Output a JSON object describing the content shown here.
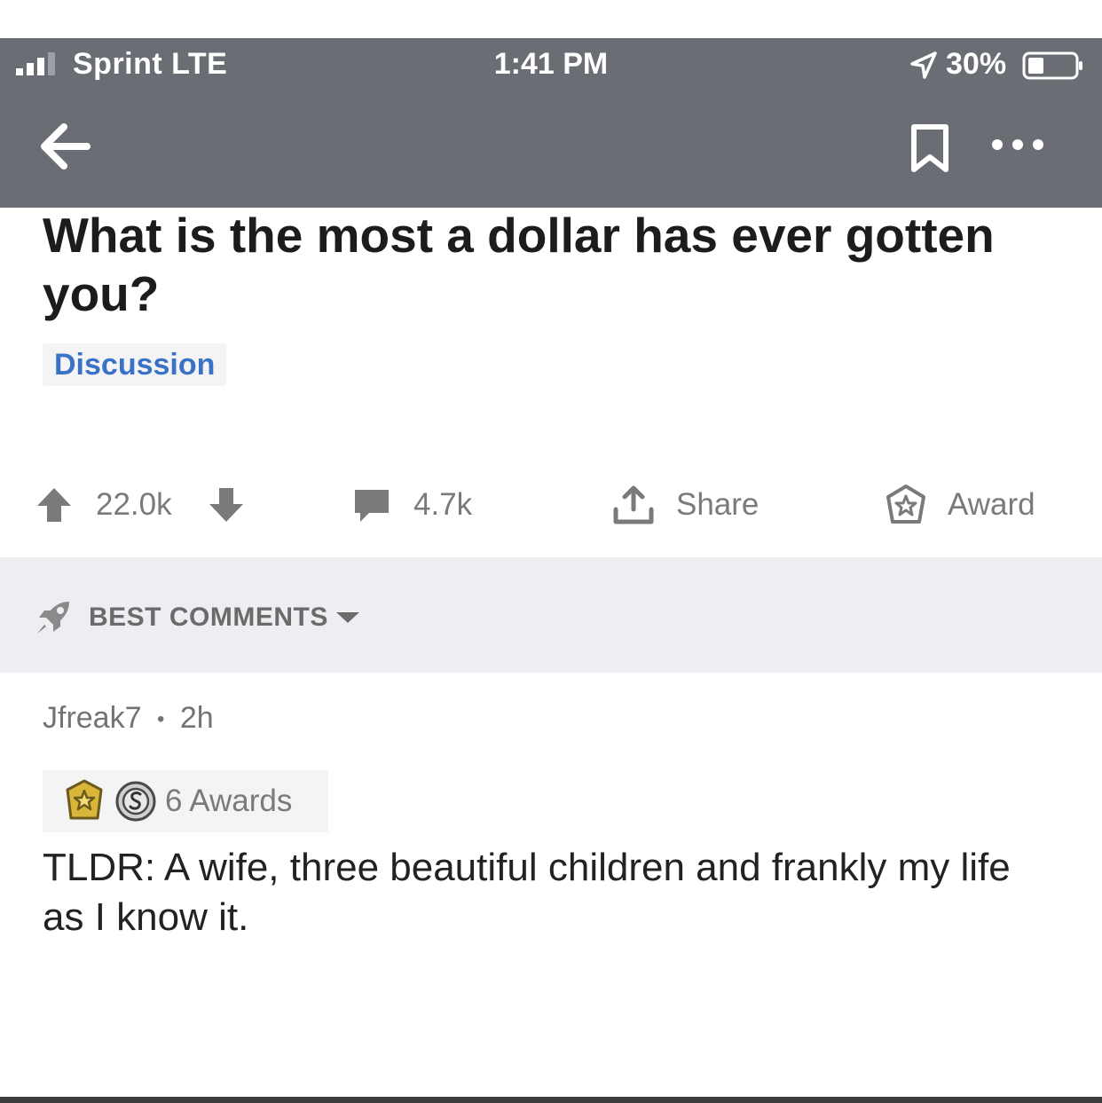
{
  "status_bar": {
    "carrier": "Sprint LTE",
    "time": "1:41 PM",
    "battery": "30%",
    "icons": [
      "signal-bars-icon",
      "location-arrow-icon",
      "battery-icon"
    ]
  },
  "nav": {
    "icons": [
      "back-arrow-icon",
      "bookmark-icon",
      "more-options-icon"
    ]
  },
  "post": {
    "title": "What is the most a dollar has ever gotten you?",
    "flair": "Discussion",
    "score": "22.0k",
    "comments_count": "4.7k",
    "share_label": "Share",
    "award_label": "Award"
  },
  "sort": {
    "label": "BEST COMMENTS"
  },
  "comment": {
    "author": "Jfreak7",
    "separator": "•",
    "age": "2h",
    "awards_label": "6 Awards",
    "body": "TLDR: A wife, three beautiful children and frankly my life as I know it."
  },
  "colors": {
    "app_bar": "#6a6e74",
    "flair_text": "#3a72c7",
    "sort_bar": "#eceef1",
    "muted_text": "#7a7a7a"
  }
}
